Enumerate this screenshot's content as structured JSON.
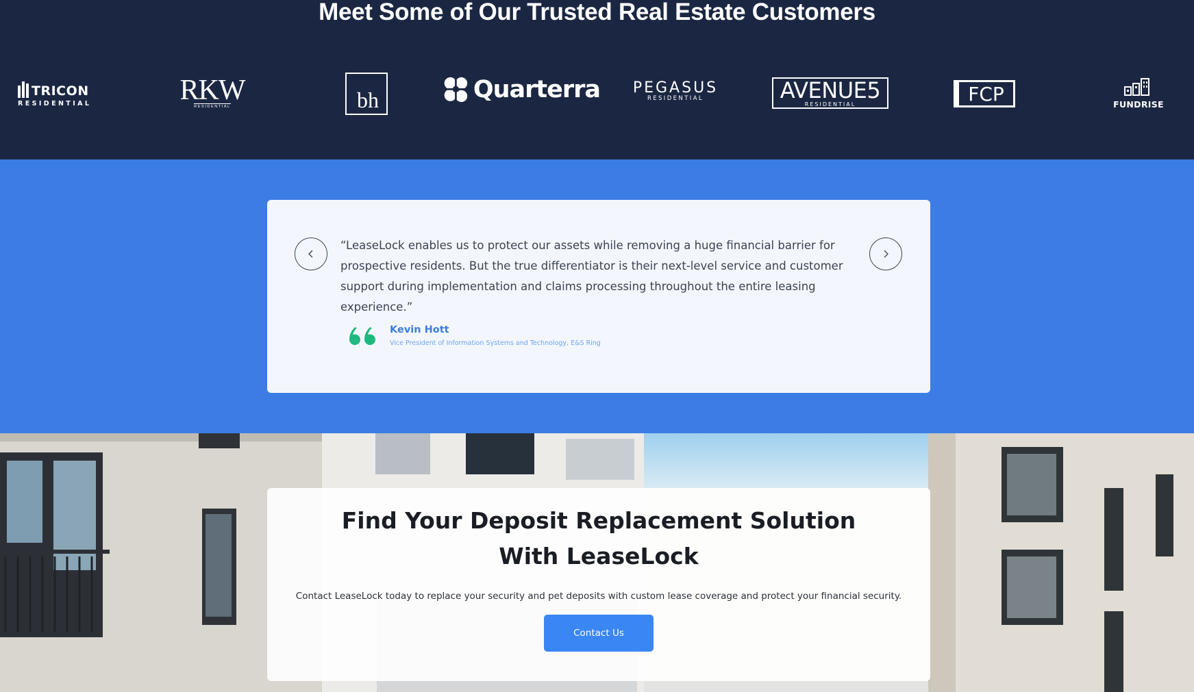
{
  "customers": {
    "heading": "Meet Some of Our Trusted Real Estate Customers",
    "logos": [
      {
        "main": "TRICON",
        "sub": "RESIDENTIAL"
      },
      {
        "main": "RKW",
        "sub": "RESIDENTIAL"
      },
      {
        "main": "bh"
      },
      {
        "main": "Quarterra"
      },
      {
        "main": "PEGASUS",
        "sub": "RESIDENTIAL"
      },
      {
        "main": "AVENUE5",
        "sub": "RESIDENTIAL"
      },
      {
        "main": "FCP"
      },
      {
        "main": "FUNDRISE"
      }
    ]
  },
  "testimonial": {
    "quote": "“LeaseLock enables us to protect our assets while removing a huge financial barrier for prospective residents. But the true differentiator is their next-level service and customer support during implementation and claims processing throughout the entire leasing experience.”",
    "author_name": "Kevin Hott",
    "author_title": "Vice President of Information Systems and Technology, E&S Ring",
    "prev_icon": "chevron-left-icon",
    "next_icon": "chevron-right-icon",
    "quote_icon": "quote-mark-icon"
  },
  "cta": {
    "title": "Find Your Deposit Replacement Solution With LeaseLock",
    "text": "Contact LeaseLock today to replace your security and pet deposits with custom lease coverage and protect your financial security.",
    "button_label": "Contact Us"
  },
  "colors": {
    "navy": "#1b2742",
    "blue": "#3b7de4",
    "button_blue": "#3a86f2",
    "quote_green": "#1fb97f",
    "card_bg": "#f3f7fd"
  }
}
